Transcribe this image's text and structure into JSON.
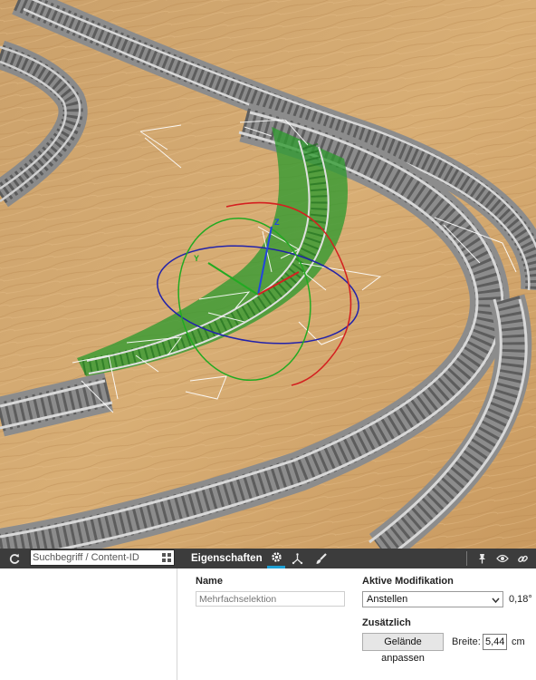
{
  "toolbar": {
    "search_placeholder": "Suchbegriff / Content-ID",
    "tab_label": "Eigenschaften",
    "icons": [
      "refresh-icon",
      "grid-icon",
      "gear-icon",
      "axes-icon",
      "brush-icon",
      "pin-icon",
      "eye-icon",
      "link-icon"
    ],
    "accent_color": "#1e9fd3"
  },
  "properties": {
    "name_label": "Name",
    "name_placeholder": "Mehrfachselektion",
    "active_mod_label": "Aktive Modifikation",
    "active_mod_value": "Anstellen",
    "angle_value": "0,18°",
    "extra_label": "Zusätzlich",
    "terrain_button": "Gelände anpassen",
    "width_label": "Breite:",
    "width_value": "5,44",
    "unit": "cm"
  },
  "viewport": {
    "ground_color": "#d6a86a",
    "selection_color": "#2f9a2f",
    "gizmo_label_z": "Z",
    "gizmo_label_y": "Y"
  }
}
